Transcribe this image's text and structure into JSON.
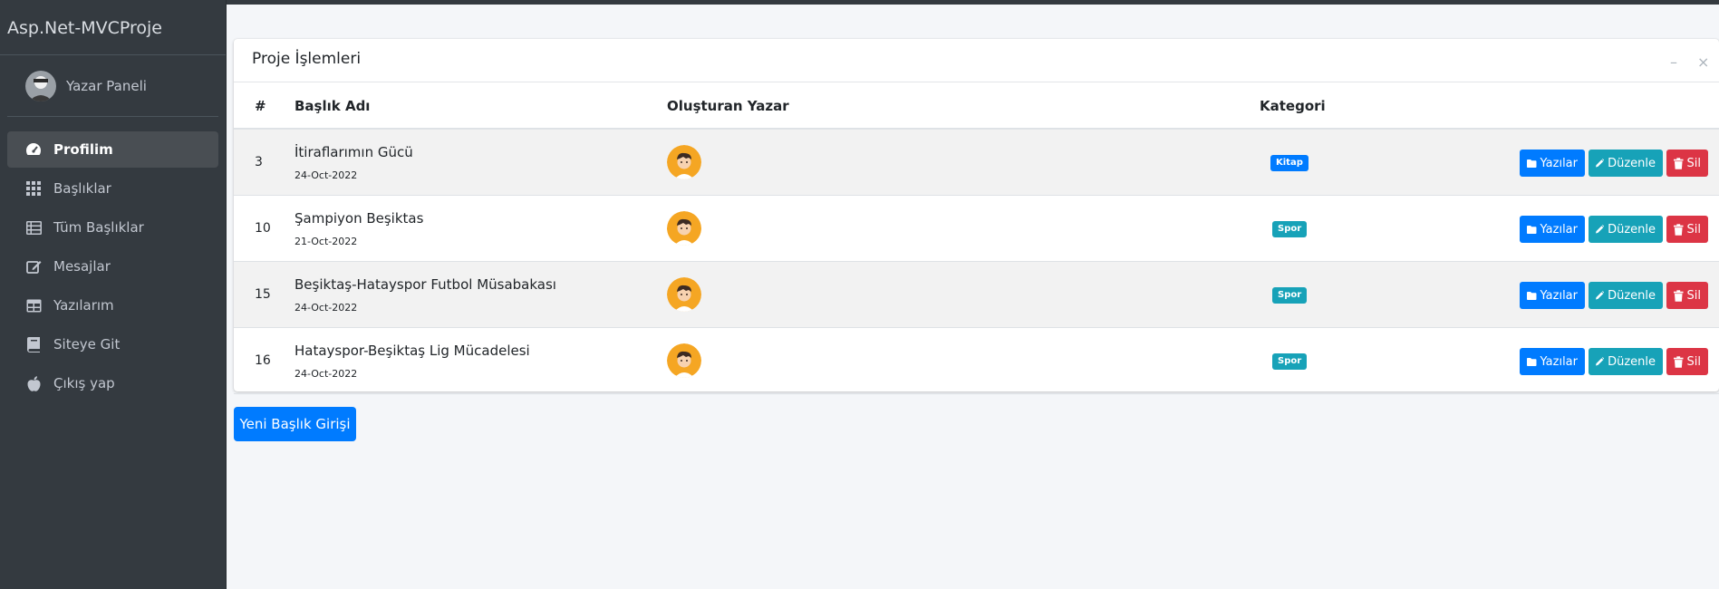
{
  "brand": "Asp.Net-MVCProje",
  "user": {
    "name": "Yazar Paneli"
  },
  "nav": [
    {
      "label": "Profilim",
      "icon": "tachometer-icon",
      "active": true
    },
    {
      "label": "Başlıklar",
      "icon": "grid-icon"
    },
    {
      "label": "Tüm Başlıklar",
      "icon": "list-icon"
    },
    {
      "label": "Mesajlar",
      "icon": "edit-icon"
    },
    {
      "label": "Yazılarım",
      "icon": "table-icon"
    },
    {
      "label": "Siteye Git",
      "icon": "book-icon"
    },
    {
      "label": "Çıkış yap",
      "icon": "apple-icon"
    }
  ],
  "card": {
    "title": "Proje İşlemleri",
    "tools": {
      "minimize": "–",
      "close": "×"
    }
  },
  "table": {
    "headers": [
      "#",
      "Başlık Adı",
      "Oluşturan Yazar",
      "Kategori"
    ],
    "rows": [
      {
        "id": "3",
        "title": "İtiraflarımın Gücü",
        "date": "24-Oct-2022",
        "category": "Kitap"
      },
      {
        "id": "10",
        "title": "Şampiyon Beşiktas",
        "date": "21-Oct-2022",
        "category": "Spor"
      },
      {
        "id": "15",
        "title": "Beşiktaş-Hatayspor Futbol Müsabakası",
        "date": "24-Oct-2022",
        "category": "Spor"
      },
      {
        "id": "16",
        "title": "Hatayspor-Beşiktaş Lig Mücadelesi",
        "date": "24-Oct-2022",
        "category": "Spor"
      }
    ],
    "actions": {
      "posts": "Yazılar",
      "edit": "Düzenle",
      "delete": "Sil"
    }
  },
  "new_button": "Yeni Başlık Girişi",
  "colors": {
    "primary": "#007bff",
    "info": "#17a2b8",
    "danger": "#dc3545",
    "sidebar": "#343a40"
  }
}
